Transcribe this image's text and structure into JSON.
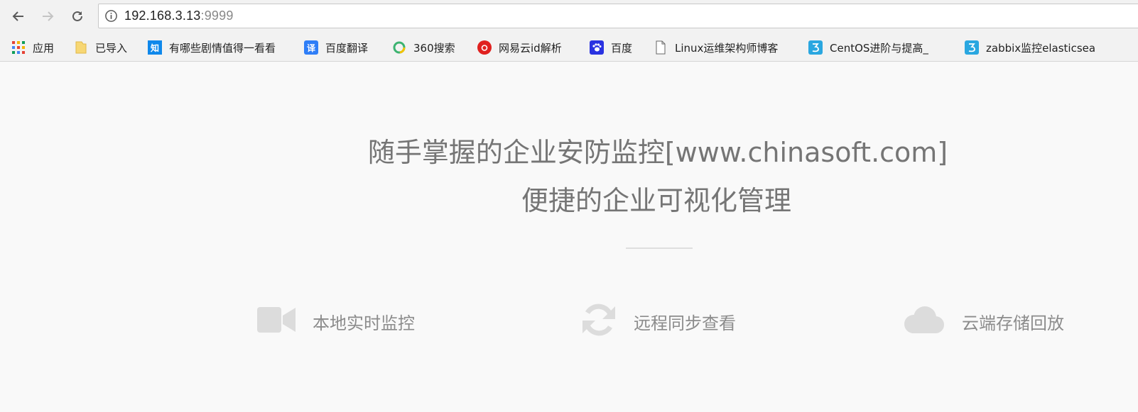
{
  "browser": {
    "url_host": "192.168.3.13",
    "url_port": ":9999",
    "bookmarks": [
      {
        "label": "应用",
        "icon": "apps-grid-icon"
      },
      {
        "label": "已导入",
        "icon": "folder-icon"
      },
      {
        "label": "有哪些剧情值得一看看",
        "icon": "zhihu-icon",
        "icon_text": "知"
      },
      {
        "label": "百度翻译",
        "icon": "baidu-translate-icon",
        "icon_text": "译"
      },
      {
        "label": "360搜索",
        "icon": "360-search-icon"
      },
      {
        "label": "网易云id解析",
        "icon": "netease-music-icon"
      },
      {
        "label": "百度",
        "icon": "baidu-paw-icon"
      },
      {
        "label": "Linux运维架构师博客",
        "icon": "page-icon"
      },
      {
        "label": "CentOS进阶与提高_",
        "icon": "bookmark-3-icon"
      },
      {
        "label": "zabbix监控elasticsea",
        "icon": "bookmark-3-icon"
      }
    ]
  },
  "page": {
    "headline1": "随手掌握的企业安防监控[www.chinasoft.com]",
    "headline2": "便捷的企业可视化管理",
    "features": [
      {
        "label": "本地实时监控",
        "icon": "video-camera-icon"
      },
      {
        "label": "远程同步查看",
        "icon": "sync-icon"
      },
      {
        "label": "云端存储回放",
        "icon": "cloud-icon"
      }
    ]
  },
  "colors": {
    "accent_zhihu": "#0f88eb",
    "accent_translate": "#2f7ef7",
    "accent_netease": "#e0211f",
    "accent_baidu": "#2932e1",
    "feature_icon": "#dcdcdc",
    "headline_text": "#757575"
  }
}
